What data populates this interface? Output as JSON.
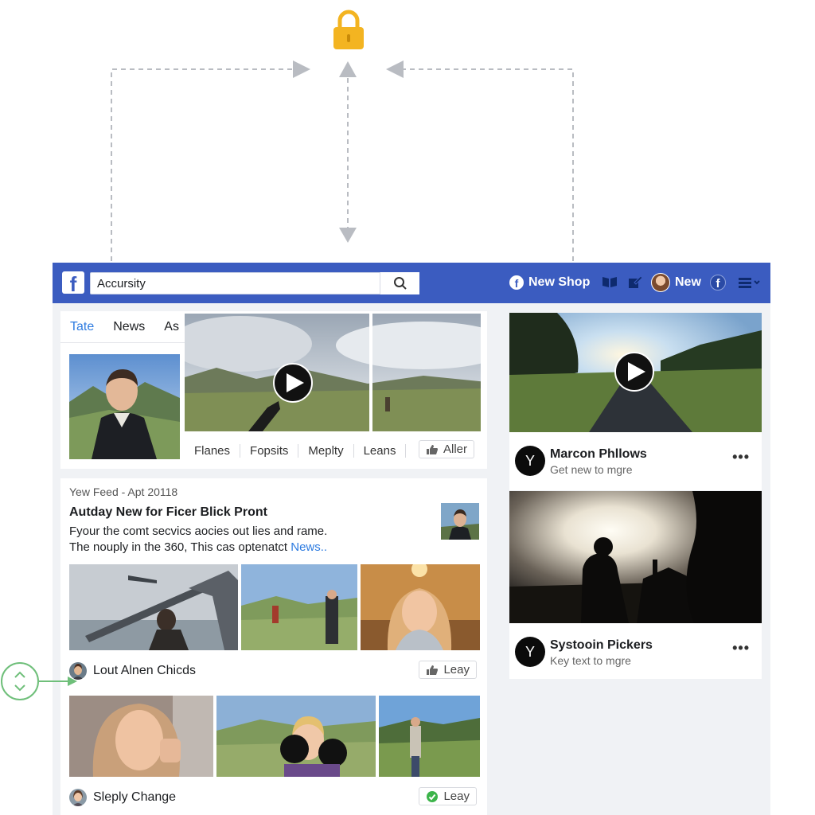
{
  "colors": {
    "brand": "#3b5cc0",
    "link": "#2d7be0",
    "lock": "#f3b421",
    "arrow": "#b9bcc2",
    "scroll_accent": "#6fbf7a"
  },
  "header": {
    "logo": "f",
    "search_value": "Accursity",
    "search_icon": "search-icon",
    "shop_icon": "f",
    "shop_label": "New Shop",
    "new_label": "New",
    "f_badge": "f"
  },
  "top_card": {
    "tabs": [
      "Tate",
      "News",
      "As"
    ],
    "actions": [
      "Flanes",
      "Fopsits",
      "Meplty",
      "Leans"
    ],
    "action_button": "Aller"
  },
  "feed": {
    "meta": "Yew Feed - Apt 20118",
    "title": "Autday New for Ficer Blick Pront",
    "body_line1": "Fyour the comt secvics aocies out lies and rame.",
    "body_line2": "The nouply in the 360, This cas optenatct ",
    "body_link": "News..",
    "post1_name": "Lout Alnen Chicds",
    "post1_button": "Leay",
    "post2_name": "Sleply Change",
    "post2_button": "Leay"
  },
  "right": {
    "card1": {
      "avatar": "Y",
      "name": "Marcon Phllows",
      "sub": "Get new to mgre",
      "more": "•••"
    },
    "card2": {
      "avatar": "Y",
      "name": "Systooin Pickers",
      "sub": "Key text to mgre",
      "more": "•••"
    }
  }
}
